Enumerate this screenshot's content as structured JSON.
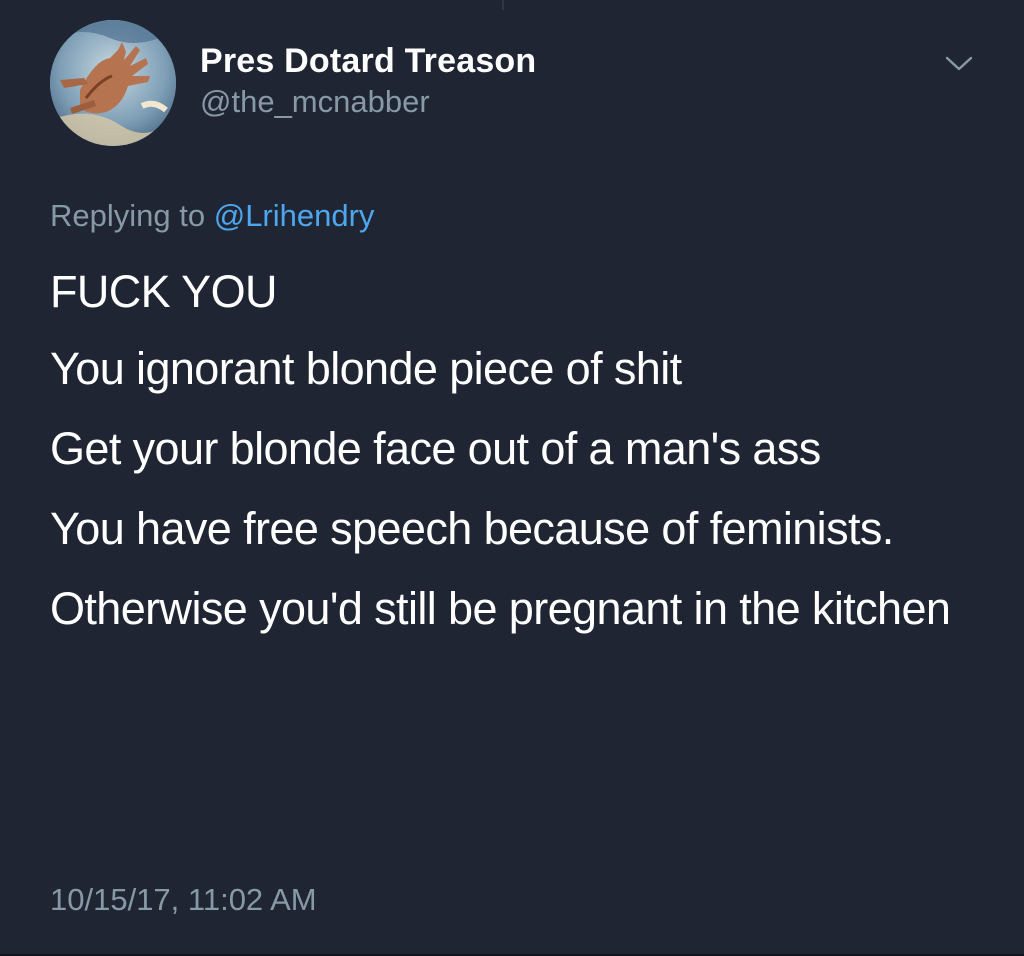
{
  "tweet": {
    "display_name": "Pres Dotard Treason",
    "handle": "@the_mcnabber",
    "reply_prefix": "Replying to",
    "reply_to": "@Lrihendry",
    "lines": [
      "FUCK YOU",
      "You ignorant blonde piece of shit",
      "Get your blonde face out of a man's ass",
      "You have free speech because of feminists.",
      "Otherwise you'd still be pregnant in the kitchen"
    ],
    "timestamp": "10/15/17, 11:02 AM"
  },
  "icons": {
    "menu": "chevron-down-icon",
    "avatar": "hands-painting-avatar"
  },
  "colors": {
    "background": "#1f2533",
    "primary_text": "#ffffff",
    "secondary_text": "#8899a6",
    "link": "#4ea6ee"
  }
}
